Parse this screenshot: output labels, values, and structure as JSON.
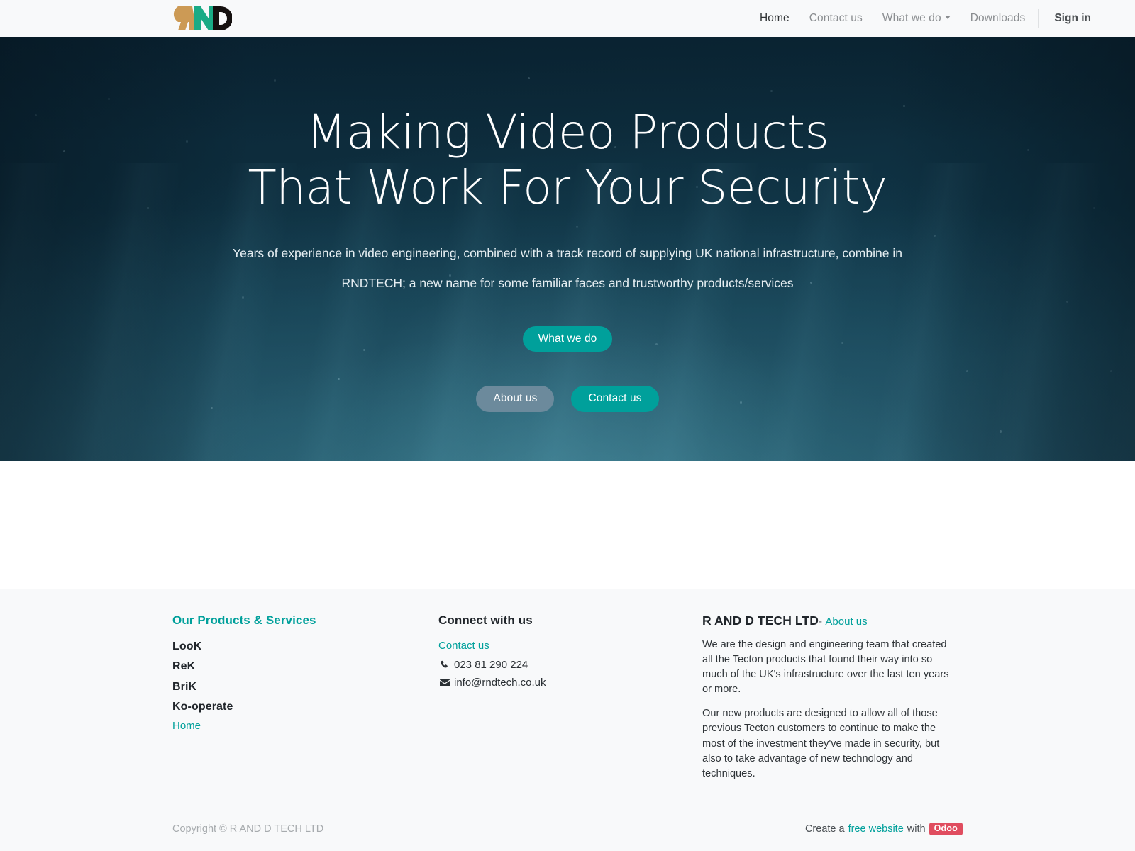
{
  "brand": {
    "logo_name": "rnd-logo",
    "logo_text": "RND",
    "colors": {
      "r": "#cc9a55",
      "n": "#1aab85",
      "d": "#15100f"
    }
  },
  "nav": {
    "items": [
      {
        "label": "Home",
        "name": "nav-link-home",
        "active": true,
        "dropdown": false
      },
      {
        "label": "Contact us",
        "name": "nav-link-contact-us",
        "active": false,
        "dropdown": false
      },
      {
        "label": "What we do",
        "name": "nav-link-what-we-do",
        "active": false,
        "dropdown": true
      },
      {
        "label": "Downloads",
        "name": "nav-link-downloads",
        "active": false,
        "dropdown": false
      }
    ],
    "sign_in": "Sign in"
  },
  "hero": {
    "title_line1": "Making Video Products",
    "title_line2": "That Work For Your Security",
    "sub_line1": "Years of experience in video engineering, combined with a track record of supplying UK national infrastructure, combine in",
    "sub_line2": "RNDTECH; a new name for some familiar faces and trustworthy products/services",
    "cta_primary": "What we do",
    "cta_secondary": "About us",
    "cta_tertiary": "Contact us",
    "colors": {
      "teal": "#00a09b",
      "slate": "#6c8a9c",
      "background_dark": "#0d2c3c"
    }
  },
  "footer": {
    "products": {
      "heading": "Our Products & Services",
      "items": [
        "LooK",
        "ReK",
        "BriK",
        "Ko-operate"
      ],
      "home_link": "Home"
    },
    "connect": {
      "heading": "Connect with us",
      "contact_link": "Contact us",
      "phone_icon": "phone-icon",
      "phone": "023 81 290 224",
      "email_icon": "envelope-icon",
      "email": "info@rndtech.co.uk"
    },
    "company": {
      "name": "R AND D TECH LTD",
      "separator": "-",
      "about_link": "About us",
      "paragraph1": "We are the design and engineering team that created all the Tecton products that found their way into so much of the UK's infrastructure over the last ten years or more.",
      "paragraph2": "Our new products are designed to allow all of those previous Tecton customers to continue to make the most of the investment they've made in security, but also to take advantage of new technology and techniques."
    },
    "bottom": {
      "copyright": "Copyright © R AND D TECH LTD",
      "attribution_prefix": "Create a",
      "attribution_link": "free website",
      "attribution_middle": "with",
      "attribution_badge": "Odoo",
      "badge_color": "#e04d5f"
    }
  }
}
